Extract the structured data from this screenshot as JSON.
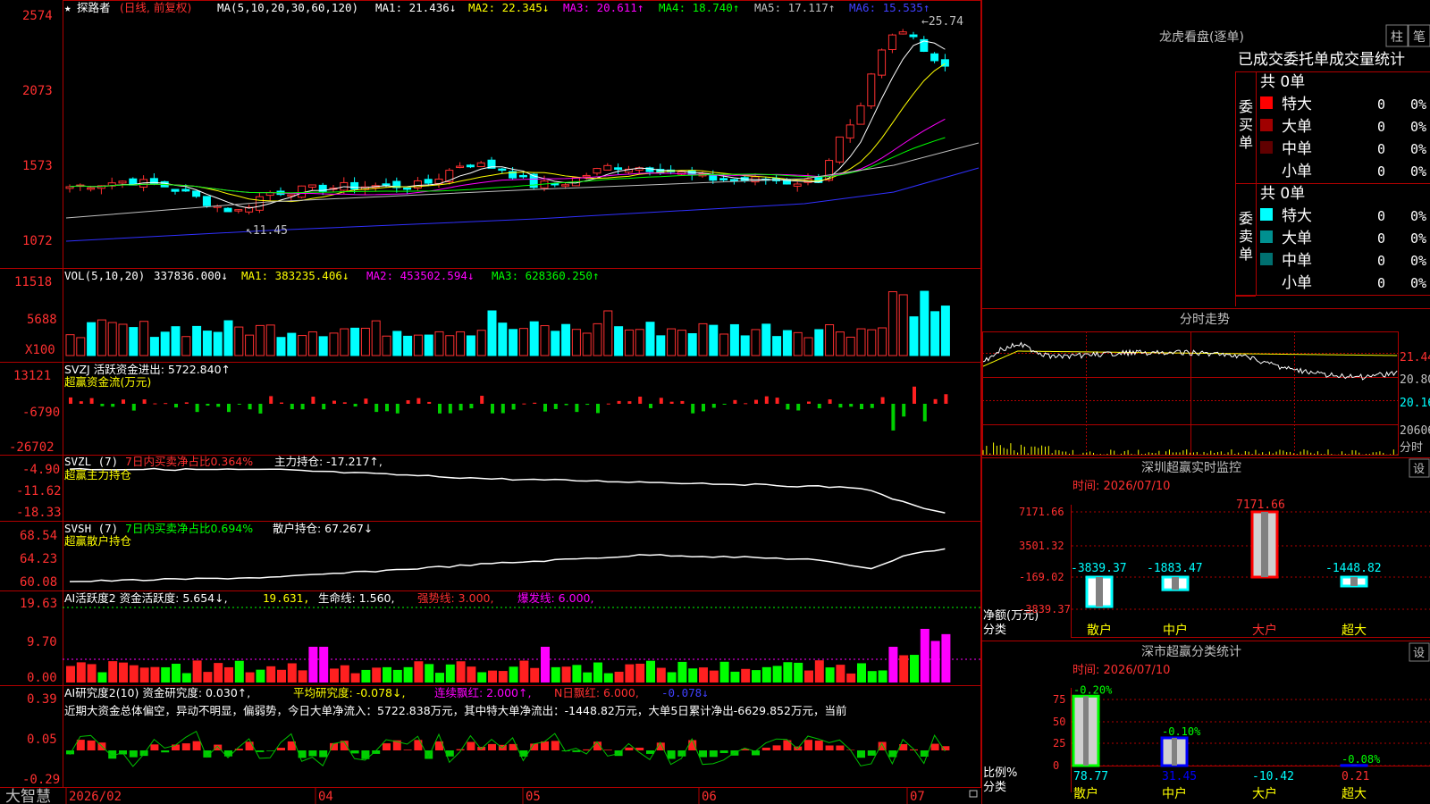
{
  "app_name": "大智慧",
  "kline": {
    "stock_name": "探路者",
    "period": "(日线, 前复权)",
    "ma_params": "MA(5,10,20,30,60,120)",
    "ma_values": [
      {
        "label": "MA1: 21.436↓",
        "color": "#ffffff"
      },
      {
        "label": "MA2: 22.345↓",
        "color": "#ffff00"
      },
      {
        "label": "MA3: 20.611↑",
        "color": "#ff00ff"
      },
      {
        "label": "MA4: 18.740↑",
        "color": "#00ff00"
      },
      {
        "label": "MA5: 17.117↑",
        "color": "#c0c0c0"
      },
      {
        "label": "MA6: 15.535↑",
        "color": "#4040ff"
      }
    ],
    "y_ticks": [
      "2574",
      "2073",
      "1573",
      "1072"
    ],
    "high_label": "25.74",
    "low_label": "11.45"
  },
  "vol": {
    "header": "VOL(5,10,20)",
    "value": "337836.000↓",
    "ma1": "MA1: 383235.406↓",
    "ma2": "MA2: 453502.594↓",
    "ma3": "MA3: 628360.250↑",
    "y_ticks": [
      "11518",
      "5688"
    ],
    "unit": "X100"
  },
  "svzj": {
    "header": "SVZJ  活跃资金进出: 5722.840↑",
    "sub": "超赢资金流(万元)",
    "y_ticks": [
      "13121",
      "-6790",
      "-26702"
    ]
  },
  "svzl": {
    "header_a": "SVZL (7)",
    "header_b": "7日内买卖净占比0.364%",
    "header_c": "主力持仓: -17.217↑,",
    "sub": "超赢主力持仓",
    "y_ticks": [
      "-4.90",
      "-11.62",
      "-18.33"
    ]
  },
  "svsh": {
    "header_a": "SVSH (7)",
    "header_b": "7日内买卖净占比0.694%",
    "header_c": "散户持仓: 67.267↓",
    "sub": "超赢散户持仓",
    "y_ticks": [
      "68.54",
      "64.23",
      "60.08"
    ]
  },
  "ai_active": {
    "header_a": "AI活跃度2 资金活跃度: 5.654↓,",
    "header_b": "19.631,",
    "header_c": "生命线: 1.560,",
    "header_d": "强势线: 3.000,",
    "header_e": "爆发线: 6.000,",
    "y_ticks": [
      "19.63",
      "9.70",
      "0.00"
    ]
  },
  "ai_research": {
    "header_a": "AI研究度2(10) 资金研究度: 0.030↑,",
    "header_b": "平均研究度: -0.078↓,",
    "header_c": "连续飘红: 2.000↑,",
    "header_d": "N日飘红: 6.000,",
    "header_e": "-0.078↓",
    "comment": "近期大资金总体偏空，异动不明显，偏弱势，今日大单净流入：5722.838万元，其中特大单净流出：-1448.82万元，大单5日累计净出-6629.852万元，当前",
    "y_ticks": [
      "0.39",
      "0.05",
      "-0.29"
    ]
  },
  "x_axis": [
    "2026/02",
    "04",
    "05",
    "06",
    "07"
  ],
  "lhb": {
    "title": "龙虎看盘(逐单)",
    "btn1": "柱",
    "btn2": "笔",
    "tabs": [
      "已成交",
      "委托单",
      "成交量",
      "统计"
    ],
    "buy_label": "委买单",
    "sell_label": "委卖单",
    "buy_total": "共 0单",
    "sell_total": "共 0单",
    "buy_rows": [
      {
        "name": "特大",
        "count": "0",
        "pct": "0%",
        "color": "#ff0000"
      },
      {
        "name": "大单",
        "count": "0",
        "pct": "0%",
        "color": "#a00000"
      },
      {
        "name": "中单",
        "count": "0",
        "pct": "0%",
        "color": "#600000"
      },
      {
        "name": "小单",
        "count": "0",
        "pct": "0%",
        "color": ""
      }
    ],
    "sell_rows": [
      {
        "name": "特大",
        "count": "0",
        "pct": "0%",
        "color": "#00ffff"
      },
      {
        "name": "大单",
        "count": "0",
        "pct": "0%",
        "color": "#009090"
      },
      {
        "name": "中单",
        "count": "0",
        "pct": "0%",
        "color": "#007070"
      },
      {
        "name": "小单",
        "count": "0",
        "pct": "0%",
        "color": ""
      }
    ]
  },
  "intraday": {
    "title": "分时走势",
    "price_labels": [
      "21.44",
      "20.80",
      "20.16"
    ],
    "vol_label": "206060",
    "vol_unit": "分时"
  },
  "sz_monitor": {
    "title": "深圳超赢实时监控",
    "btn": "设",
    "time": "时间: 2026/07/10",
    "y_ticks": [
      "7171.66",
      "3501.32",
      "-169.02",
      "-3839.37"
    ],
    "unit_label": "净额(万元)",
    "cat_label": "分类",
    "categories": [
      "散户",
      "中户",
      "大户",
      "超大"
    ],
    "values": [
      -3839.37,
      -1883.47,
      7171.66,
      -1448.82
    ],
    "value_labels": [
      "-3839.37",
      "-1883.47",
      "7171.66",
      "-1448.82"
    ]
  },
  "sz_class": {
    "title": "深市超赢分类统计",
    "btn": "设",
    "time": "时间: 2026/07/10",
    "y_ticks": [
      "75",
      "50",
      "25",
      "0"
    ],
    "unit_label": "比例%",
    "cat_label": "分类",
    "categories": [
      "散户",
      "中户",
      "大户",
      "超大"
    ],
    "values": [
      78.77,
      31.45,
      -10.42,
      0.21
    ],
    "top_labels": [
      "-0.20%",
      "-0.10%",
      "",
      "-0.08%"
    ]
  }
}
